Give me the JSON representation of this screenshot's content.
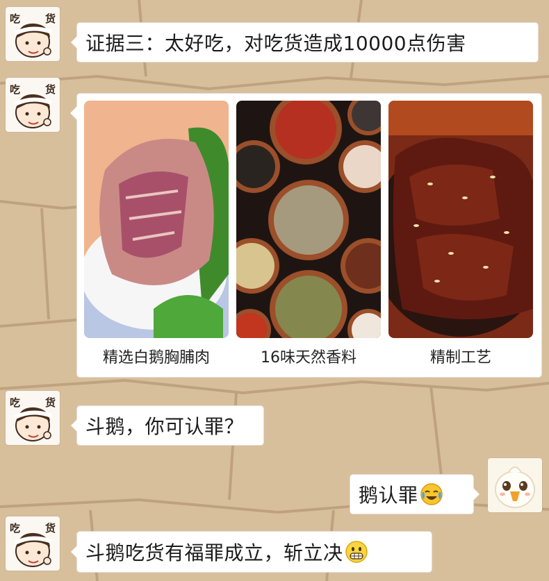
{
  "chat": {
    "sender_tag_left": "吃",
    "sender_tag_right": "货",
    "messages": [
      {
        "text": "证据三：太好吃，对吃货造成10000点伤害"
      },
      {
        "text": "斗鹅，你可认罪？"
      },
      {
        "text": "鹅认罪",
        "emoji": "crying-laughing-emoji"
      },
      {
        "text": "斗鹅吃货有福罪成立，斩立决",
        "emoji": "grin-emoji"
      }
    ],
    "photo_card": {
      "items": [
        {
          "caption": "精选白鹅胸脯肉",
          "image": "raw-goose-meat-photo"
        },
        {
          "caption": "16味天然香料",
          "image": "spices-bowls-photo"
        },
        {
          "caption": "精制工艺",
          "image": "braised-goose-photo"
        }
      ]
    }
  },
  "colors": {
    "background": "#d8bf9c",
    "bubble": "#ffffff",
    "text": "#1c1c1c"
  }
}
